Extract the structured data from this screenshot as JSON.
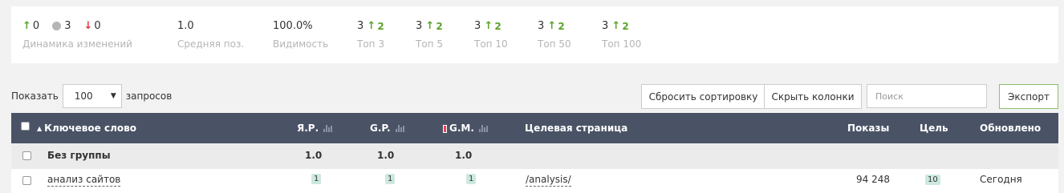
{
  "stats": {
    "dynamics": {
      "up": "0",
      "neutral": "3",
      "down": "0",
      "label": "Динамика изменений"
    },
    "avg_pos": {
      "value": "1.0",
      "label": "Средняя поз."
    },
    "visibility": {
      "value": "100.0%",
      "label": "Видимость"
    },
    "top3": {
      "value": "3",
      "delta": "2",
      "label": "Топ 3"
    },
    "top5": {
      "value": "3",
      "delta": "2",
      "label": "Топ 5"
    },
    "top10": {
      "value": "3",
      "delta": "2",
      "label": "Топ 10"
    },
    "top50": {
      "value": "3",
      "delta": "2",
      "label": "Топ 50"
    },
    "top100": {
      "value": "3",
      "delta": "2",
      "label": "Топ 100"
    }
  },
  "toolbar": {
    "show_label": "Показать",
    "show_value": "100",
    "requests_label": "запросов",
    "reset_sort": "Сбросить сортировку",
    "hide_columns": "Скрыть колонки",
    "search_placeholder": "Поиск",
    "export": "Экспорт"
  },
  "table": {
    "headers": {
      "keyword": "Ключевое слово",
      "yr": "Я.Р.",
      "gr": "G.P.",
      "gm": "G.M.",
      "target": "Целевая страница",
      "impressions": "Показы",
      "goal": "Цель",
      "updated": "Обновлено"
    },
    "group_row": {
      "name": "Без группы",
      "yr": "1.0",
      "gr": "1.0",
      "gm": "1.0"
    },
    "rows": [
      {
        "keyword": "анализ сайтов",
        "yr": "1",
        "gr": "1",
        "gm": "1",
        "target": "/analysis/",
        "impressions": "94 248",
        "goal": "10",
        "updated": "Сегодня"
      }
    ]
  },
  "colors": {
    "header_bg": "#4a5366",
    "up": "#5ba32b",
    "down": "#e03b3b",
    "badge": "#cde9df"
  }
}
